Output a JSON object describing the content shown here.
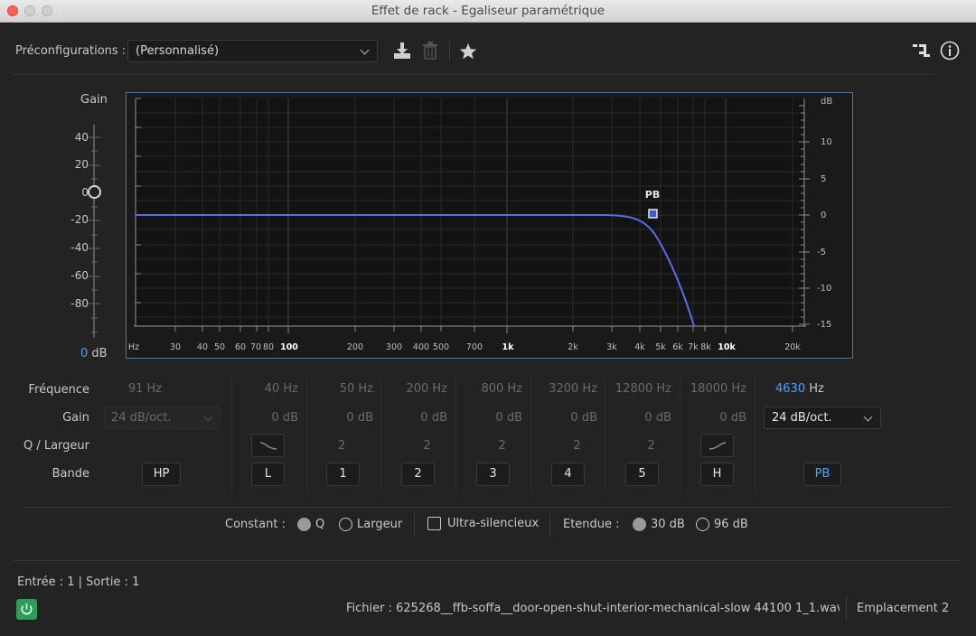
{
  "window": {
    "title": "Effet de rack - Egaliseur paramétrique"
  },
  "toolbar": {
    "presets_label": "Préconfigurations :",
    "preset_value": "(Personnalisé)",
    "icons": [
      "download-icon",
      "trash-icon",
      "star-icon",
      "routing-icon",
      "info-icon"
    ]
  },
  "gain_panel": {
    "title": "Gain",
    "ticks": [
      "40",
      "20",
      "0",
      "-20",
      "-40",
      "-60",
      "-80"
    ],
    "value": "0",
    "unit": "dB"
  },
  "graph": {
    "right_unit": "dB",
    "right_ticks": [
      "10",
      "5",
      "0",
      "-5",
      "-10",
      "-15"
    ],
    "freq_unit": "Hz",
    "freq_ticks": [
      "30",
      "40",
      "50",
      "60",
      "70",
      "80",
      "100",
      "200",
      "300",
      "400",
      "500",
      "700",
      "1k",
      "2k",
      "3k",
      "4k",
      "5k",
      "6k",
      "7k",
      "8k",
      "10k",
      "20k"
    ],
    "node_label": "PB",
    "curve_color": "#5b6cf0",
    "accent": "#2f7fd0"
  },
  "bands": {
    "row_labels": {
      "freq": "Fréquence",
      "gain": "Gain",
      "q": "Q / Largeur",
      "band": "Bande"
    },
    "hp": {
      "freq": "91 Hz",
      "gain": "24 dB/oct.",
      "button": "HP"
    },
    "l": {
      "freq": "40 Hz",
      "gain": "0 dB",
      "button": "L"
    },
    "b1": {
      "freq": "50 Hz",
      "gain": "0 dB",
      "q": "2",
      "button": "1"
    },
    "b2": {
      "freq": "200 Hz",
      "gain": "0 dB",
      "q": "2",
      "button": "2"
    },
    "b3": {
      "freq": "800 Hz",
      "gain": "0 dB",
      "q": "2",
      "button": "3"
    },
    "b4": {
      "freq": "3200 Hz",
      "gain": "0 dB",
      "q": "2",
      "button": "4"
    },
    "b5": {
      "freq": "12800 Hz",
      "gain": "0 dB",
      "q": "2",
      "button": "5"
    },
    "h": {
      "freq": "18000 Hz",
      "gain": "0 dB",
      "button": "H"
    },
    "pb": {
      "freq_value": "4630",
      "freq_unit": "Hz",
      "gain": "24 dB/oct.",
      "button": "PB"
    }
  },
  "options": {
    "constant_label": "Constant :",
    "q_label": "Q",
    "width_label": "Largeur",
    "ultra_label": "Ultra-silencieux",
    "range_label": "Etendue :",
    "r30_label": "30 dB",
    "r96_label": "96 dB"
  },
  "footer": {
    "io": "Entrée : 1 | Sortie : 1",
    "file": "Fichier : 625268__ffb-soffa__door-open-shut-interior-mechanical-slow 44100 1_1.wav",
    "slot": "Emplacement 2"
  }
}
